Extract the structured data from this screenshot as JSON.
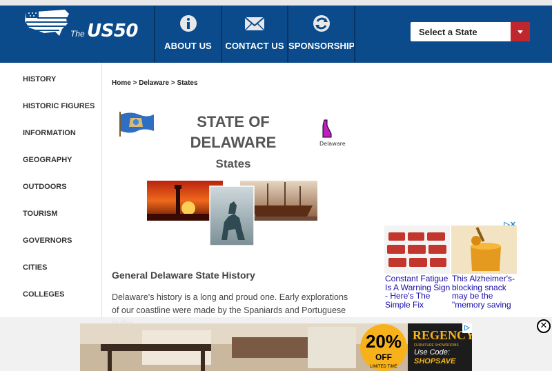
{
  "header": {
    "logo_the": "The",
    "logo_name": "US50",
    "nav": [
      {
        "label": "ABOUT US",
        "icon": "info-icon"
      },
      {
        "label": "CONTACT US",
        "icon": "envelope-icon"
      },
      {
        "label": "SPONSORSHIP",
        "icon": "recycle-icon"
      }
    ],
    "state_select": {
      "value": "Select a State"
    }
  },
  "sidebar": {
    "items": [
      "HISTORY",
      "HISTORIC FIGURES",
      "INFORMATION",
      "GEOGRAPHY",
      "OUTDOORS",
      "TOURISM",
      "GOVERNORS",
      "CITIES",
      "COLLEGES"
    ]
  },
  "breadcrumb": {
    "home": "Home",
    "sep1": " > ",
    "state": "Delaware",
    "sep2": " > ",
    "current": "States"
  },
  "main": {
    "title_line1": "STATE OF",
    "title_line2": "DELAWARE",
    "subtitle": "States",
    "map_label": "Delaware",
    "section_heading": "General Delaware State History",
    "paragraph": "Delaware's history is a long and proud one. Early explorations of our coastline were made by the Spaniards and Portuguese in the"
  },
  "ads": {
    "side": [
      {
        "text": "Constant Fatigue Is A Warning Sign - Here's The Simple Fix"
      },
      {
        "text": "This Alzheimer's-blocking snack may be the \"memory saving"
      }
    ],
    "banner": {
      "brand": "REGENCY",
      "brand_sub": "FURNITURE SHOWROOMS",
      "discount": "20%",
      "off": "OFF",
      "limited": "LIMITED TIME",
      "code_label": "Use Code:",
      "code": "SHOPSAVE"
    },
    "close_glyph": "✕"
  },
  "colors": {
    "header_bg": "#0b4a8b",
    "select_button": "#c0262d",
    "ad_link": "#1a0dab"
  }
}
